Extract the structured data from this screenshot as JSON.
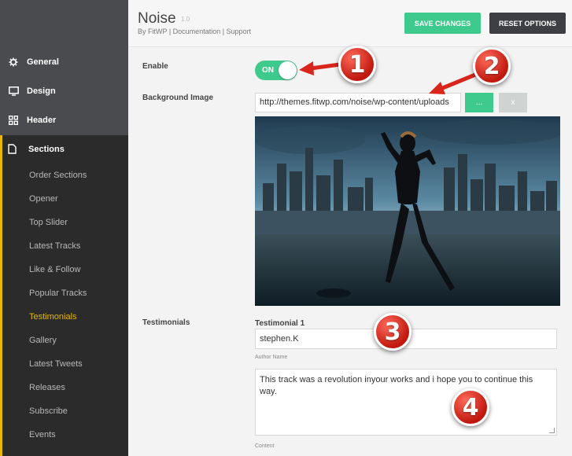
{
  "header": {
    "title": "Noise",
    "version": "1.0",
    "byline": "By FitWP | Documentation | Support",
    "save_label": "SAVE CHANGES",
    "reset_label": "RESET OPTIONS"
  },
  "sidebar": {
    "main_items": [
      {
        "label": "General",
        "icon": "gear-icon"
      },
      {
        "label": "Design",
        "icon": "monitor-icon"
      },
      {
        "label": "Header",
        "icon": "grid-icon"
      }
    ],
    "sections_label": "Sections",
    "sections_icon": "document-icon",
    "sub_items": [
      "Order Sections",
      "Opener",
      "Top Slider",
      "Latest Tracks",
      "Like & Follow",
      "Popular Tracks",
      "Testimonials",
      "Gallery",
      "Latest Tweets",
      "Releases",
      "Subscribe",
      "Events"
    ],
    "active_item": "Testimonials"
  },
  "form": {
    "enable_label": "Enable",
    "toggle_text": "ON",
    "bg_label": "Background Image",
    "bg_url": "http://themes.fitwp.com/noise/wp-content/uploads",
    "upload_label": "...",
    "remove_label": "x",
    "testimonials_label": "Testimonials",
    "testimonial_title": "Testimonial 1",
    "author_value": "stephen.K",
    "author_hint": "Author Name",
    "content_value": "This track was a revolution inyour works and i hope you to continue this way.",
    "content_hint": "Content"
  },
  "callouts": [
    "1",
    "2",
    "3",
    "4"
  ],
  "colors": {
    "accent_green": "#3ec98d",
    "sidebar_dark": "#2b2b2b",
    "sidebar_top": "#4a4b4e",
    "active_yellow": "#e6b800",
    "callout_red": "#d9261c"
  }
}
